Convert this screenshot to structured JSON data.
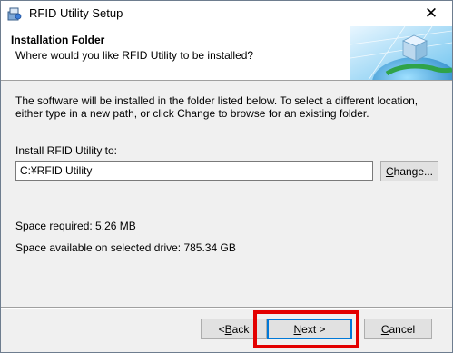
{
  "window": {
    "title": "RFID Utility Setup",
    "close_glyph": "✕",
    "icon": "setup-installer-icon"
  },
  "header": {
    "title": "Installation Folder",
    "subtitle": "Where would you like RFID Utility to be installed?",
    "banner_icon": "globe-with-cube-banner"
  },
  "main": {
    "description": "The software will be installed in the folder listed below. To select a different location, either type in a new path, or click Change to browse for an existing folder.",
    "install_label": "Install RFID Utility to:",
    "install_path": "C:¥RFID Utility",
    "change_button": {
      "prefix": "",
      "mnemonic": "C",
      "rest": "hange..."
    },
    "space_required": "Space required: 5.26 MB",
    "space_available": "Space available on selected drive: 785.34 GB"
  },
  "footer": {
    "back_button": {
      "prefix": "< ",
      "mnemonic": "B",
      "rest": "ack"
    },
    "next_button": {
      "prefix": "",
      "mnemonic": "N",
      "rest": "ext >"
    },
    "cancel_button": {
      "prefix": "",
      "mnemonic": "C",
      "rest": "ancel"
    }
  },
  "colors": {
    "highlight": "#e30000",
    "default_button_border": "#0078d7",
    "dialog_bg": "#f0f0f0"
  }
}
